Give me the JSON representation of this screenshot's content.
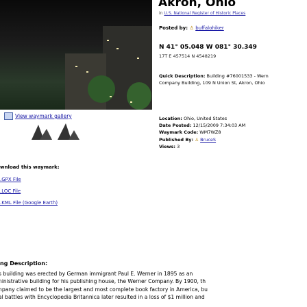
{
  "title": "Akron, Ohio",
  "subtitle_prefix": "in",
  "subtitle_link": "U.S. National Register of Historic Places",
  "posted_by_label": "Posted by:",
  "posted_by_user": "buffalohiker",
  "coordinates": "N 41° 05.048 W 081° 30.349",
  "utm": "17T E 457514 N 4548219",
  "quick_description_label": "Quick Description:",
  "quick_description_lines": [
    "Building #76001533 - Wern",
    "Company Building, 109 N Union St, Akron, Ohio"
  ],
  "gallery_link": "View waymark gallery",
  "location_label": "Location:",
  "location_value": "Ohio, United States",
  "date_posted_label": "Date Posted:",
  "date_posted_value": "12/15/2009 7:34:03 AM",
  "waymark_code_label": "Waymark Code:",
  "waymark_code_value": "WM7WZ8",
  "published_by_label": "Published By:",
  "published_by_user": "BruceS",
  "views_label": "Views:",
  "views_value": "3",
  "download_heading": "wnload this waymark:",
  "downloads": [
    ".GPX File",
    ".LOC File",
    ".KML File (Google Earth)"
  ],
  "description_heading": "ng Description:",
  "description_lines": [
    "s building was erected by German immigrant Paul E. Werner in 1895 as an",
    "ninistrative building for his publishing house, the Werner Company. By 1900, th",
    "npany claimed to be the largest and most complete book factory in America, bu",
    "al battles with Encyclopedia Britannica later resulted in a loss of $1 million and"
  ]
}
